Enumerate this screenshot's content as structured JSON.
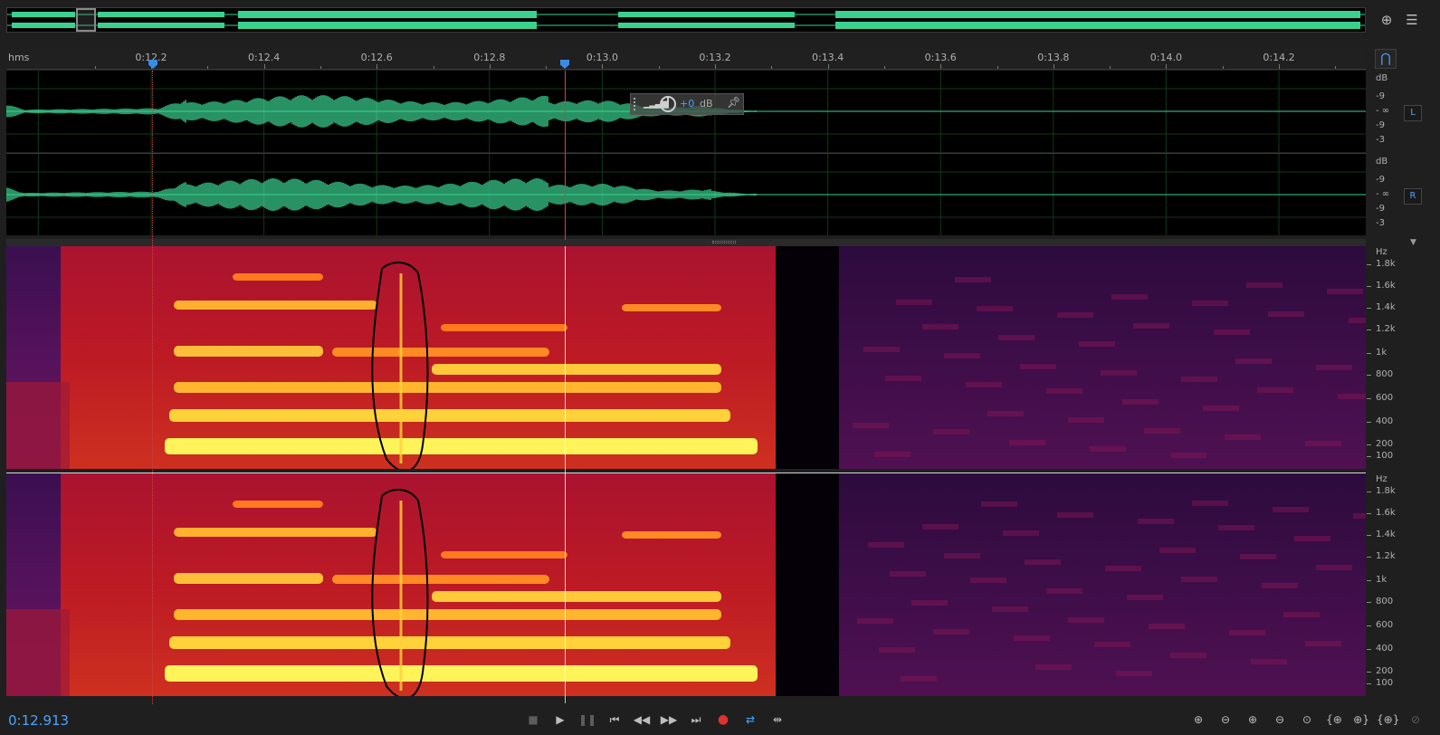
{
  "overview": {
    "label": "Overview"
  },
  "ruler": {
    "unit": "hms",
    "ticks": [
      "0:12.2",
      "0:12.4",
      "0:12.6",
      "0:12.8",
      "0:13.0",
      "0:13.2",
      "0:13.4",
      "0:13.6",
      "0:13.8",
      "0:14.0",
      "0:14.2"
    ]
  },
  "hud": {
    "gain_value": "+0",
    "gain_unit": "dB"
  },
  "waveform_scale": {
    "unit": "dB",
    "labels": [
      "-9",
      "- ∞",
      "-9",
      "-3"
    ],
    "channels": [
      "L",
      "R"
    ]
  },
  "spectral_scale": {
    "unit": "Hz",
    "labels": [
      "1.8k",
      "1.6k",
      "1.4k",
      "1.2k",
      "1k",
      "800",
      "600",
      "400",
      "200",
      "100"
    ]
  },
  "transport": {
    "time": "0:12.913",
    "buttons": [
      "stop",
      "play",
      "pause",
      "go-to-start",
      "rewind",
      "fast-forward",
      "go-to-end",
      "record",
      "loop",
      "skip-selection"
    ]
  },
  "zoom": {
    "buttons": [
      "zoom-in-amplitude",
      "zoom-out-amplitude",
      "zoom-in-time",
      "zoom-out-time",
      "zoom-full",
      "zoom-in-selection-left",
      "zoom-in-selection-right",
      "zoom-selection",
      "zoom-reset"
    ]
  },
  "colors": {
    "waveform": "#3ad18f",
    "accent": "#4aa3ff",
    "playhead": "#e33333",
    "record": "#e0312f"
  }
}
